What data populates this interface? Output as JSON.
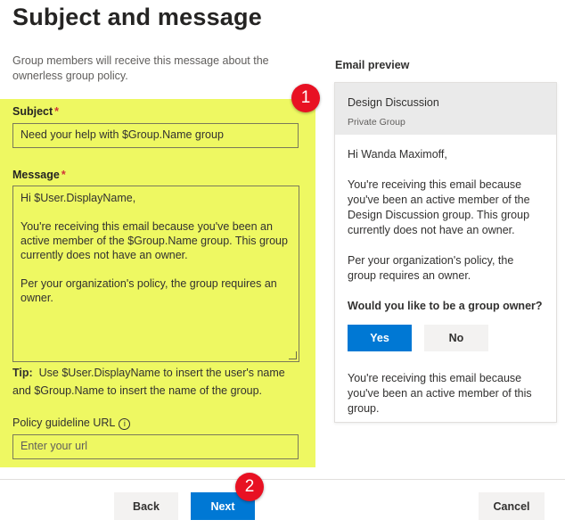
{
  "page": {
    "title": "Subject and message",
    "intro": "Group members will receive this message about the ownerless group policy."
  },
  "form": {
    "subject_label": "Subject",
    "required_mark": "*",
    "subject_value": "Need your help with $Group.Name group",
    "message_label": "Message",
    "message_lines": [
      "Hi $User.DisplayName,",
      "You're receiving this email because you've been an active member of the $Group.Name group. This group currently does not have an owner.",
      "Per your organization's policy, the group requires an owner."
    ],
    "tip_label": "Tip:",
    "tip_text": "Use $User.DisplayName to insert the user's name and $Group.Name to insert the name of the group.",
    "policy_label": "Policy guideline URL",
    "info_glyph": "i",
    "policy_placeholder": "Enter your url"
  },
  "preview": {
    "heading": "Email preview",
    "group_name": "Design Discussion",
    "group_type": "Private Group",
    "greeting": "Hi Wanda Maximoff,",
    "para1": "You're receiving this email because you've been an active member of the Design Discussion group. This group currently does not have an owner.",
    "para2": "Per your organization's policy, the group requires an owner.",
    "question": "Would you like to be a group owner?",
    "yes_label": "Yes",
    "no_label": "No",
    "footer": "You're receiving this email because you've been an active member of this group."
  },
  "footer": {
    "back_label": "Back",
    "next_label": "Next",
    "cancel_label": "Cancel"
  },
  "annotations": {
    "badge1": "1",
    "badge2": "2"
  },
  "colors": {
    "highlight": "#eef862",
    "primary": "#0078d4",
    "badge": "#e81123",
    "required": "#d13438"
  }
}
